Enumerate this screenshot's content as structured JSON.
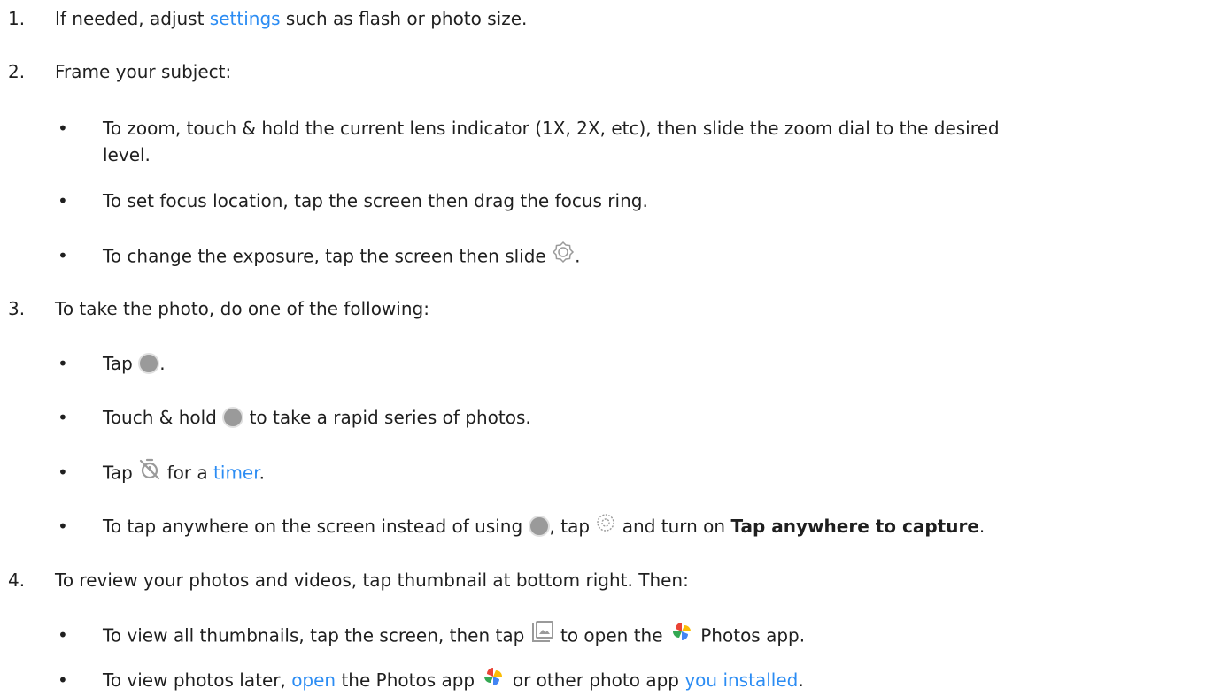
{
  "steps": [
    {
      "number": "1.",
      "pre": "If needed, adjust ",
      "link": "settings",
      "post": " such as flash or photo size."
    },
    {
      "number": "2.",
      "text": "Frame your subject:",
      "bullets": [
        {
          "text_line1": "To zoom, touch & hold the current lens indicator (1X, 2X, etc), then slide the zoom dial to the desired",
          "text_line2": "level."
        },
        {
          "text": "To set focus location, tap the screen then drag the focus ring."
        },
        {
          "pre": "To change the exposure, tap the screen then slide ",
          "post": "."
        }
      ]
    },
    {
      "number": "3.",
      "text": "To take the photo, do one of the following:",
      "bullets": [
        {
          "pre": "Tap ",
          "post": "."
        },
        {
          "pre": "Touch & hold ",
          "post": " to take a rapid series of photos."
        },
        {
          "pre": "Tap ",
          "mid": " for a ",
          "link": "timer",
          "post": "."
        },
        {
          "pre": "To tap anywhere on the screen instead of using ",
          "mid": ", tap ",
          "mid2": " and turn on ",
          "bold": "Tap anywhere to capture",
          "post": "."
        }
      ]
    },
    {
      "number": "4.",
      "text": "To review your photos and videos, tap thumbnail at bottom right. Then:",
      "bullets": [
        {
          "pre": "To view all thumbnails, tap the screen, then tap ",
          "mid": " to open the ",
          "post": " Photos app."
        },
        {
          "pre": "To view photos later, ",
          "link1": "open",
          "mid": " the Photos app ",
          "mid2": " or other photo app ",
          "link2": "you installed",
          "post": "."
        }
      ]
    }
  ],
  "bullet_char": "•",
  "icons": {
    "exposure": "exposure-sun-icon",
    "shutter": "shutter-button-icon",
    "timer": "timer-off-icon",
    "settings": "settings-gear-icon",
    "gallery": "gallery-thumbnail-icon",
    "photos": "google-photos-pinwheel-icon"
  },
  "colors": {
    "link": "#2b8cf3",
    "text": "#1f1f1f",
    "shutter_fill": "#9a9a9a",
    "photos_red": "#ea4335",
    "photos_yellow": "#fbbc04",
    "photos_green": "#34a853",
    "photos_blue": "#4285f4"
  }
}
